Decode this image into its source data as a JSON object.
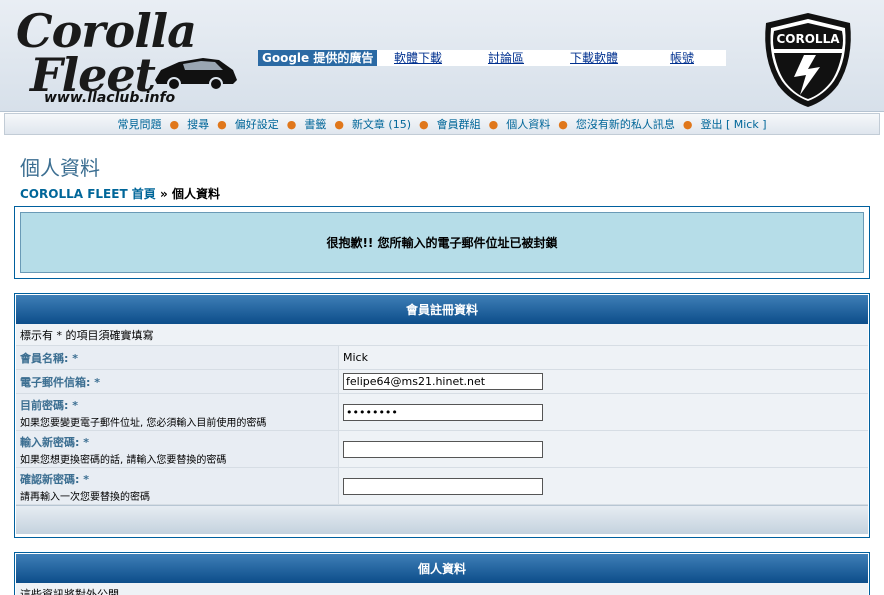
{
  "header": {
    "logo": {
      "line1": "Corolla",
      "line2": "Fleet",
      "url": "www.llaclub.info"
    },
    "google_ads_label": "Google 提供的廣告",
    "links": [
      "軟體下載",
      "討論區",
      "下載軟體",
      "帳號"
    ],
    "badge_text": "COROLLA"
  },
  "nav": {
    "items": [
      "常見問題",
      "搜尋",
      "偏好設定",
      "書籤",
      "新文章 (15)",
      "會員群組",
      "個人資料",
      "您沒有新的私人訊息",
      "登出 [ Mick ]"
    ]
  },
  "page": {
    "title": "個人資料",
    "breadcrumb_home": "COROLLA FLEET 首頁",
    "breadcrumb_sep": "»",
    "breadcrumb_current": "個人資料"
  },
  "message": "很抱歉!! 您所輸入的電子郵件位址已被封鎖",
  "registration": {
    "heading": "會員註冊資料",
    "required_note": "標示有 * 的項目須確實填寫",
    "username_label": "會員名稱: *",
    "username_value": "Mick",
    "email_label": "電子郵件信箱: *",
    "email_value": "felipe64@ms21.hinet.net",
    "current_pw_label": "目前密碼: *",
    "current_pw_hint": "如果您要變更電子郵件位址, 您必須輸入目前使用的密碼",
    "current_pw_value": "********",
    "new_pw_label": "輸入新密碼: *",
    "new_pw_hint": "如果您想更換密碼的話, 請輸入您要替換的密碼",
    "confirm_pw_label": "確認新密碼: *",
    "confirm_pw_hint": "請再輸入一次您要替換的密碼"
  },
  "profile": {
    "heading": "個人資料",
    "note": "這些資訊將對外公開"
  },
  "colors": {
    "accent": "#006699",
    "header_blue": "#0c4d8a",
    "message_bg": "#b6dde8",
    "nav_dot": "#e0771b"
  }
}
